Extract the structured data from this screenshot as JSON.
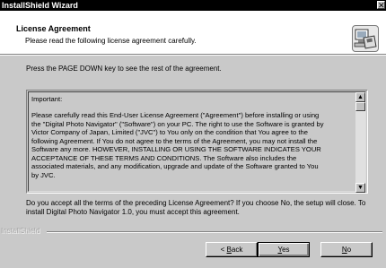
{
  "window": {
    "title": "InstallShield Wizard",
    "close_glyph": "✕"
  },
  "header": {
    "title": "License Agreement",
    "subtitle": "Please read the following license agreement carefully.",
    "icon": "installer-computer-icon"
  },
  "instruction": "Press the PAGE DOWN key to see the rest of the agreement.",
  "license": {
    "heading": "Important:",
    "lines": [
      "Please carefully read this End-User License Agreement (\"Agreement\") before installing or using",
      "the \"Digital Photo Navigator\" (\"Software\") on your PC. The right to use the Software is granted by",
      "Victor Company of Japan, Limited (\"JVC\") to You only on the condition that You agree to the",
      "following Agreement. If You do not agree to the terms of the Agreement, you may not install the",
      "Software any more. HOWEVER, INSTALLING OR USING THE SOFTWARE INDICATES YOUR",
      "ACCEPTANCE OF THESE TERMS AND CONDITIONS. The Software also includes the",
      "associated materials, and any modification, upgrade and update of the Software granted to You",
      "by JVC."
    ]
  },
  "question": "Do you accept all the terms of the preceding License Agreement? If you choose No, the setup will close. To install Digital Photo Navigator 1.0, you must accept this agreement.",
  "footer": {
    "brand": "InstallShield",
    "back_key": "B",
    "back_prefix": "< ",
    "back_rest": "ack",
    "yes_key": "Y",
    "yes_rest": "es",
    "no_key": "N",
    "no_rest": "o"
  },
  "scrollbar": {
    "up_glyph": "▲",
    "down_glyph": "▼"
  }
}
